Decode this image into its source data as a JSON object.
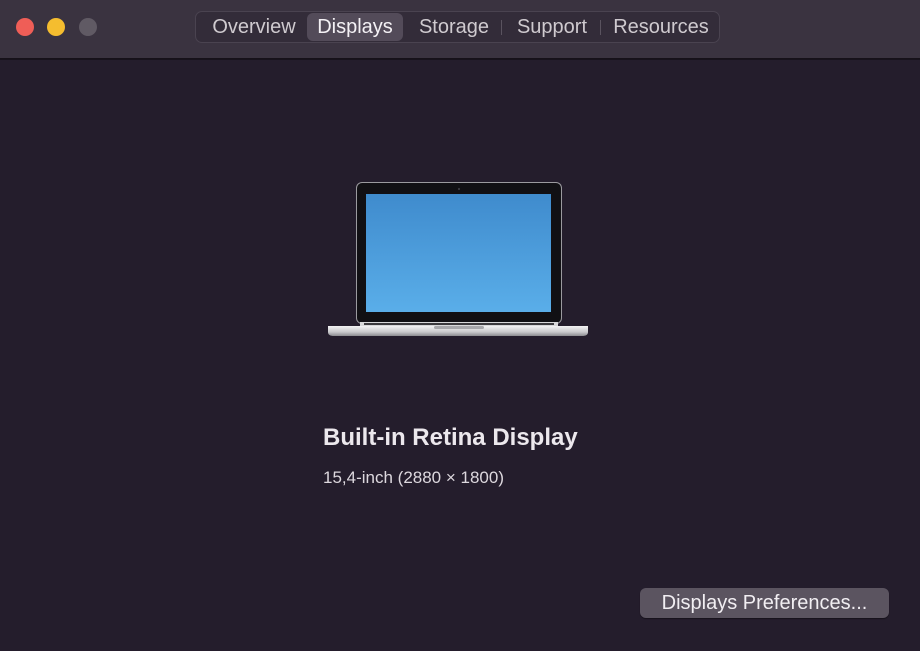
{
  "window": {
    "traffic_lights": {
      "close_color": "#ef5e57",
      "minimize_color": "#f5bd2f",
      "zoom_color": "#605a64"
    }
  },
  "tabs": [
    {
      "label": "Overview",
      "active": false
    },
    {
      "label": "Displays",
      "active": true
    },
    {
      "label": "Storage",
      "active": false
    },
    {
      "label": "Support",
      "active": false
    },
    {
      "label": "Resources",
      "active": false
    }
  ],
  "display": {
    "icon": "laptop-icon",
    "name": "Built-in Retina Display",
    "detail": "15,4-inch (2880 × 1800)"
  },
  "actions": {
    "preferences_label": "Displays Preferences..."
  },
  "colors": {
    "background": "#241d2c",
    "titlebar": "#3a3340",
    "screen_top": "#3f8bcd",
    "screen_bottom": "#5aaee9"
  }
}
